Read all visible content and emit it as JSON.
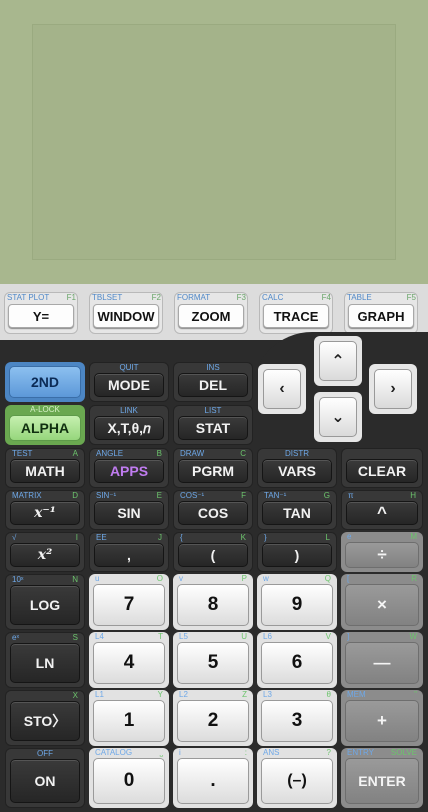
{
  "function_row": [
    {
      "top_label": "STAT PLOT",
      "fn": "F1",
      "label": "Y="
    },
    {
      "top_label": "TBLSET",
      "fn": "F2",
      "label": "WINDOW"
    },
    {
      "top_label": "FORMAT",
      "fn": "F3",
      "label": "ZOOM"
    },
    {
      "top_label": "CALC",
      "fn": "F4",
      "label": "TRACE"
    },
    {
      "top_label": "TABLE",
      "fn": "F5",
      "label": "GRAPH"
    }
  ],
  "arrows": {
    "up": "⌃",
    "left": "‹",
    "right": "›",
    "down": "⌄"
  },
  "keys": {
    "second": {
      "label": "2ND"
    },
    "mode": {
      "label": "MODE",
      "second": "QUIT"
    },
    "del": {
      "label": "DEL",
      "second": "INS"
    },
    "alpha": {
      "label": "ALPHA",
      "second": "A-LOCK"
    },
    "xt": {
      "label": "X,T,θ,𝑛",
      "second": "LINK"
    },
    "stat": {
      "label": "STAT",
      "second": "LIST"
    },
    "math": {
      "label": "MATH",
      "second": "TEST",
      "alpha": "A"
    },
    "apps": {
      "label": "APPS",
      "second": "ANGLE",
      "alpha": "B"
    },
    "prgm": {
      "label": "PGRM",
      "second": "DRAW",
      "alpha": "C"
    },
    "vars": {
      "label": "VARS",
      "second": "DISTR"
    },
    "clear": {
      "label": "CLEAR"
    },
    "inverse": {
      "label": "x⁻¹",
      "second": "MATRIX",
      "alpha": "D"
    },
    "sin": {
      "label": "SIN",
      "second": "SIN⁻¹",
      "alpha": "E"
    },
    "cos": {
      "label": "COS",
      "second": "COS⁻¹",
      "alpha": "F"
    },
    "tan": {
      "label": "TAN",
      "second": "TAN⁻¹",
      "alpha": "G"
    },
    "power": {
      "label": "^",
      "second": "π",
      "alpha": "H"
    },
    "square": {
      "label": "x²",
      "second": "√",
      "alpha": "I"
    },
    "comma": {
      "label": ",",
      "second": "EE",
      "alpha": "J"
    },
    "lparen": {
      "label": "(",
      "second": "{",
      "alpha": "K"
    },
    "rparen": {
      "label": ")",
      "second": "}",
      "alpha": "L"
    },
    "divide": {
      "label": "÷",
      "second": "e",
      "alpha": "M"
    },
    "log": {
      "label": "LOG",
      "second": "10ˣ",
      "alpha": "N"
    },
    "seven": {
      "label": "7",
      "second": "u",
      "alpha": "O"
    },
    "eight": {
      "label": "8",
      "second": "v",
      "alpha": "P"
    },
    "nine": {
      "label": "9",
      "second": "w",
      "alpha": "Q"
    },
    "multiply": {
      "label": "×",
      "second": "[",
      "alpha": "R"
    },
    "ln": {
      "label": "LN",
      "second": "eˣ",
      "alpha": "S"
    },
    "four": {
      "label": "4",
      "second": "L4",
      "alpha": "T"
    },
    "five": {
      "label": "5",
      "second": "L5",
      "alpha": "U"
    },
    "six": {
      "label": "6",
      "second": "L6",
      "alpha": "V"
    },
    "minus": {
      "label": "—",
      "second": "]",
      "alpha": "W"
    },
    "sto": {
      "label": "STO〉",
      "alpha": "X"
    },
    "one": {
      "label": "1",
      "second": "L1",
      "alpha": "Y"
    },
    "two": {
      "label": "2",
      "second": "L2",
      "alpha": "Z"
    },
    "three": {
      "label": "3",
      "second": "L3",
      "alpha": "θ"
    },
    "plus": {
      "label": "+",
      "second": "MEM",
      "alpha": "\""
    },
    "on": {
      "label": "ON",
      "second": "OFF"
    },
    "zero": {
      "label": "0",
      "second": "CATALOG",
      "alpha": "⎵"
    },
    "dot": {
      "label": ".",
      "second": "i",
      "alpha": ":"
    },
    "neg": {
      "label": "(–)",
      "second": "ANS",
      "alpha": "?"
    },
    "enter": {
      "label": "ENTER",
      "second": "ENTRY",
      "alpha": "SOLVE"
    }
  }
}
